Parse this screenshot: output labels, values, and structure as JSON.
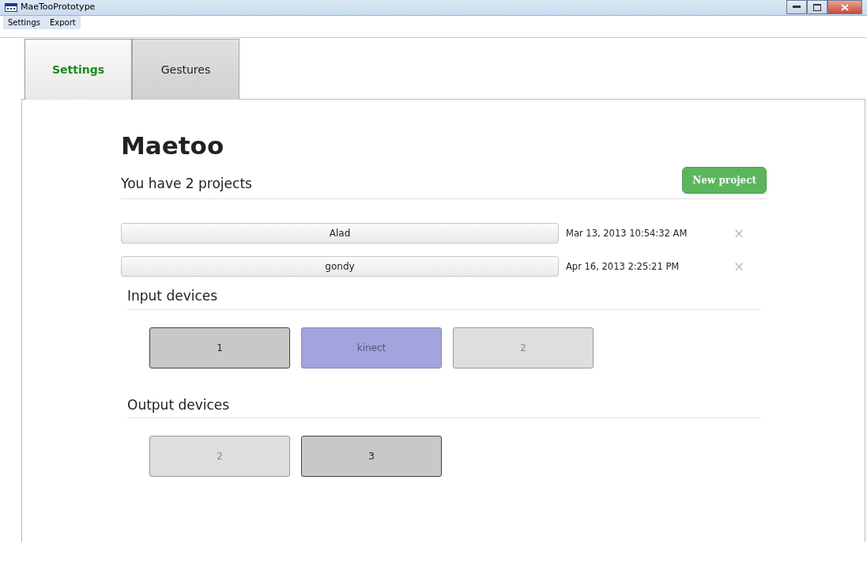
{
  "window": {
    "title": "MaeTooPrototype"
  },
  "menu": [
    "Settings",
    "Export"
  ],
  "tabs": [
    {
      "label": "Settings",
      "selected": true
    },
    {
      "label": "Gestures",
      "selected": false
    }
  ],
  "heading": "Maetoo",
  "projects_summary": "You have 2 projects",
  "new_project_button": "New project",
  "projects": [
    {
      "name": "Alad",
      "date": "Mar 13, 2013 10:54:32 AM",
      "remove": "×"
    },
    {
      "name": "gondy",
      "date": "Apr 16, 2013 2:25:21 PM",
      "remove": "×"
    }
  ],
  "input_devices": {
    "title": "Input devices",
    "devices": [
      {
        "label": "1",
        "kind": "active"
      },
      {
        "label": "kinect",
        "kind": "highlighted"
      },
      {
        "label": "2",
        "kind": "inactive"
      }
    ]
  },
  "output_devices": {
    "title": "Output devices",
    "devices": [
      {
        "label": "2",
        "kind": "inactive"
      },
      {
        "label": "3",
        "kind": "active"
      }
    ]
  }
}
